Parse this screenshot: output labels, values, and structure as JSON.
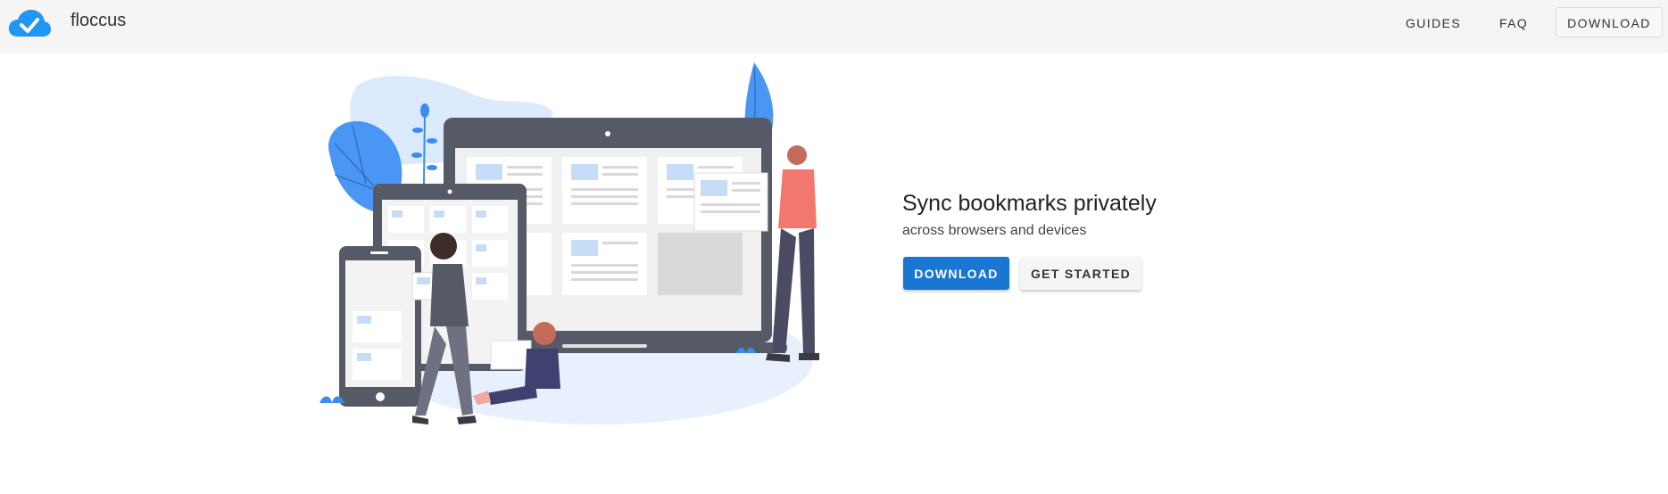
{
  "header": {
    "app_name": "floccus",
    "nav": {
      "guides": "GUIDES",
      "faq": "FAQ",
      "download": "DOWNLOAD"
    }
  },
  "hero": {
    "title": "Sync bookmarks privately",
    "subtitle": "across browsers and devices",
    "primary_button": "DOWNLOAD",
    "secondary_button": "GET STARTED"
  },
  "colors": {
    "header_bg": "#f5f5f5",
    "brand_blue": "#1976d2",
    "logo_blue": "#2196f3",
    "device_dark": "#565a67"
  },
  "icons": {
    "logo": "cloud-check-icon"
  }
}
